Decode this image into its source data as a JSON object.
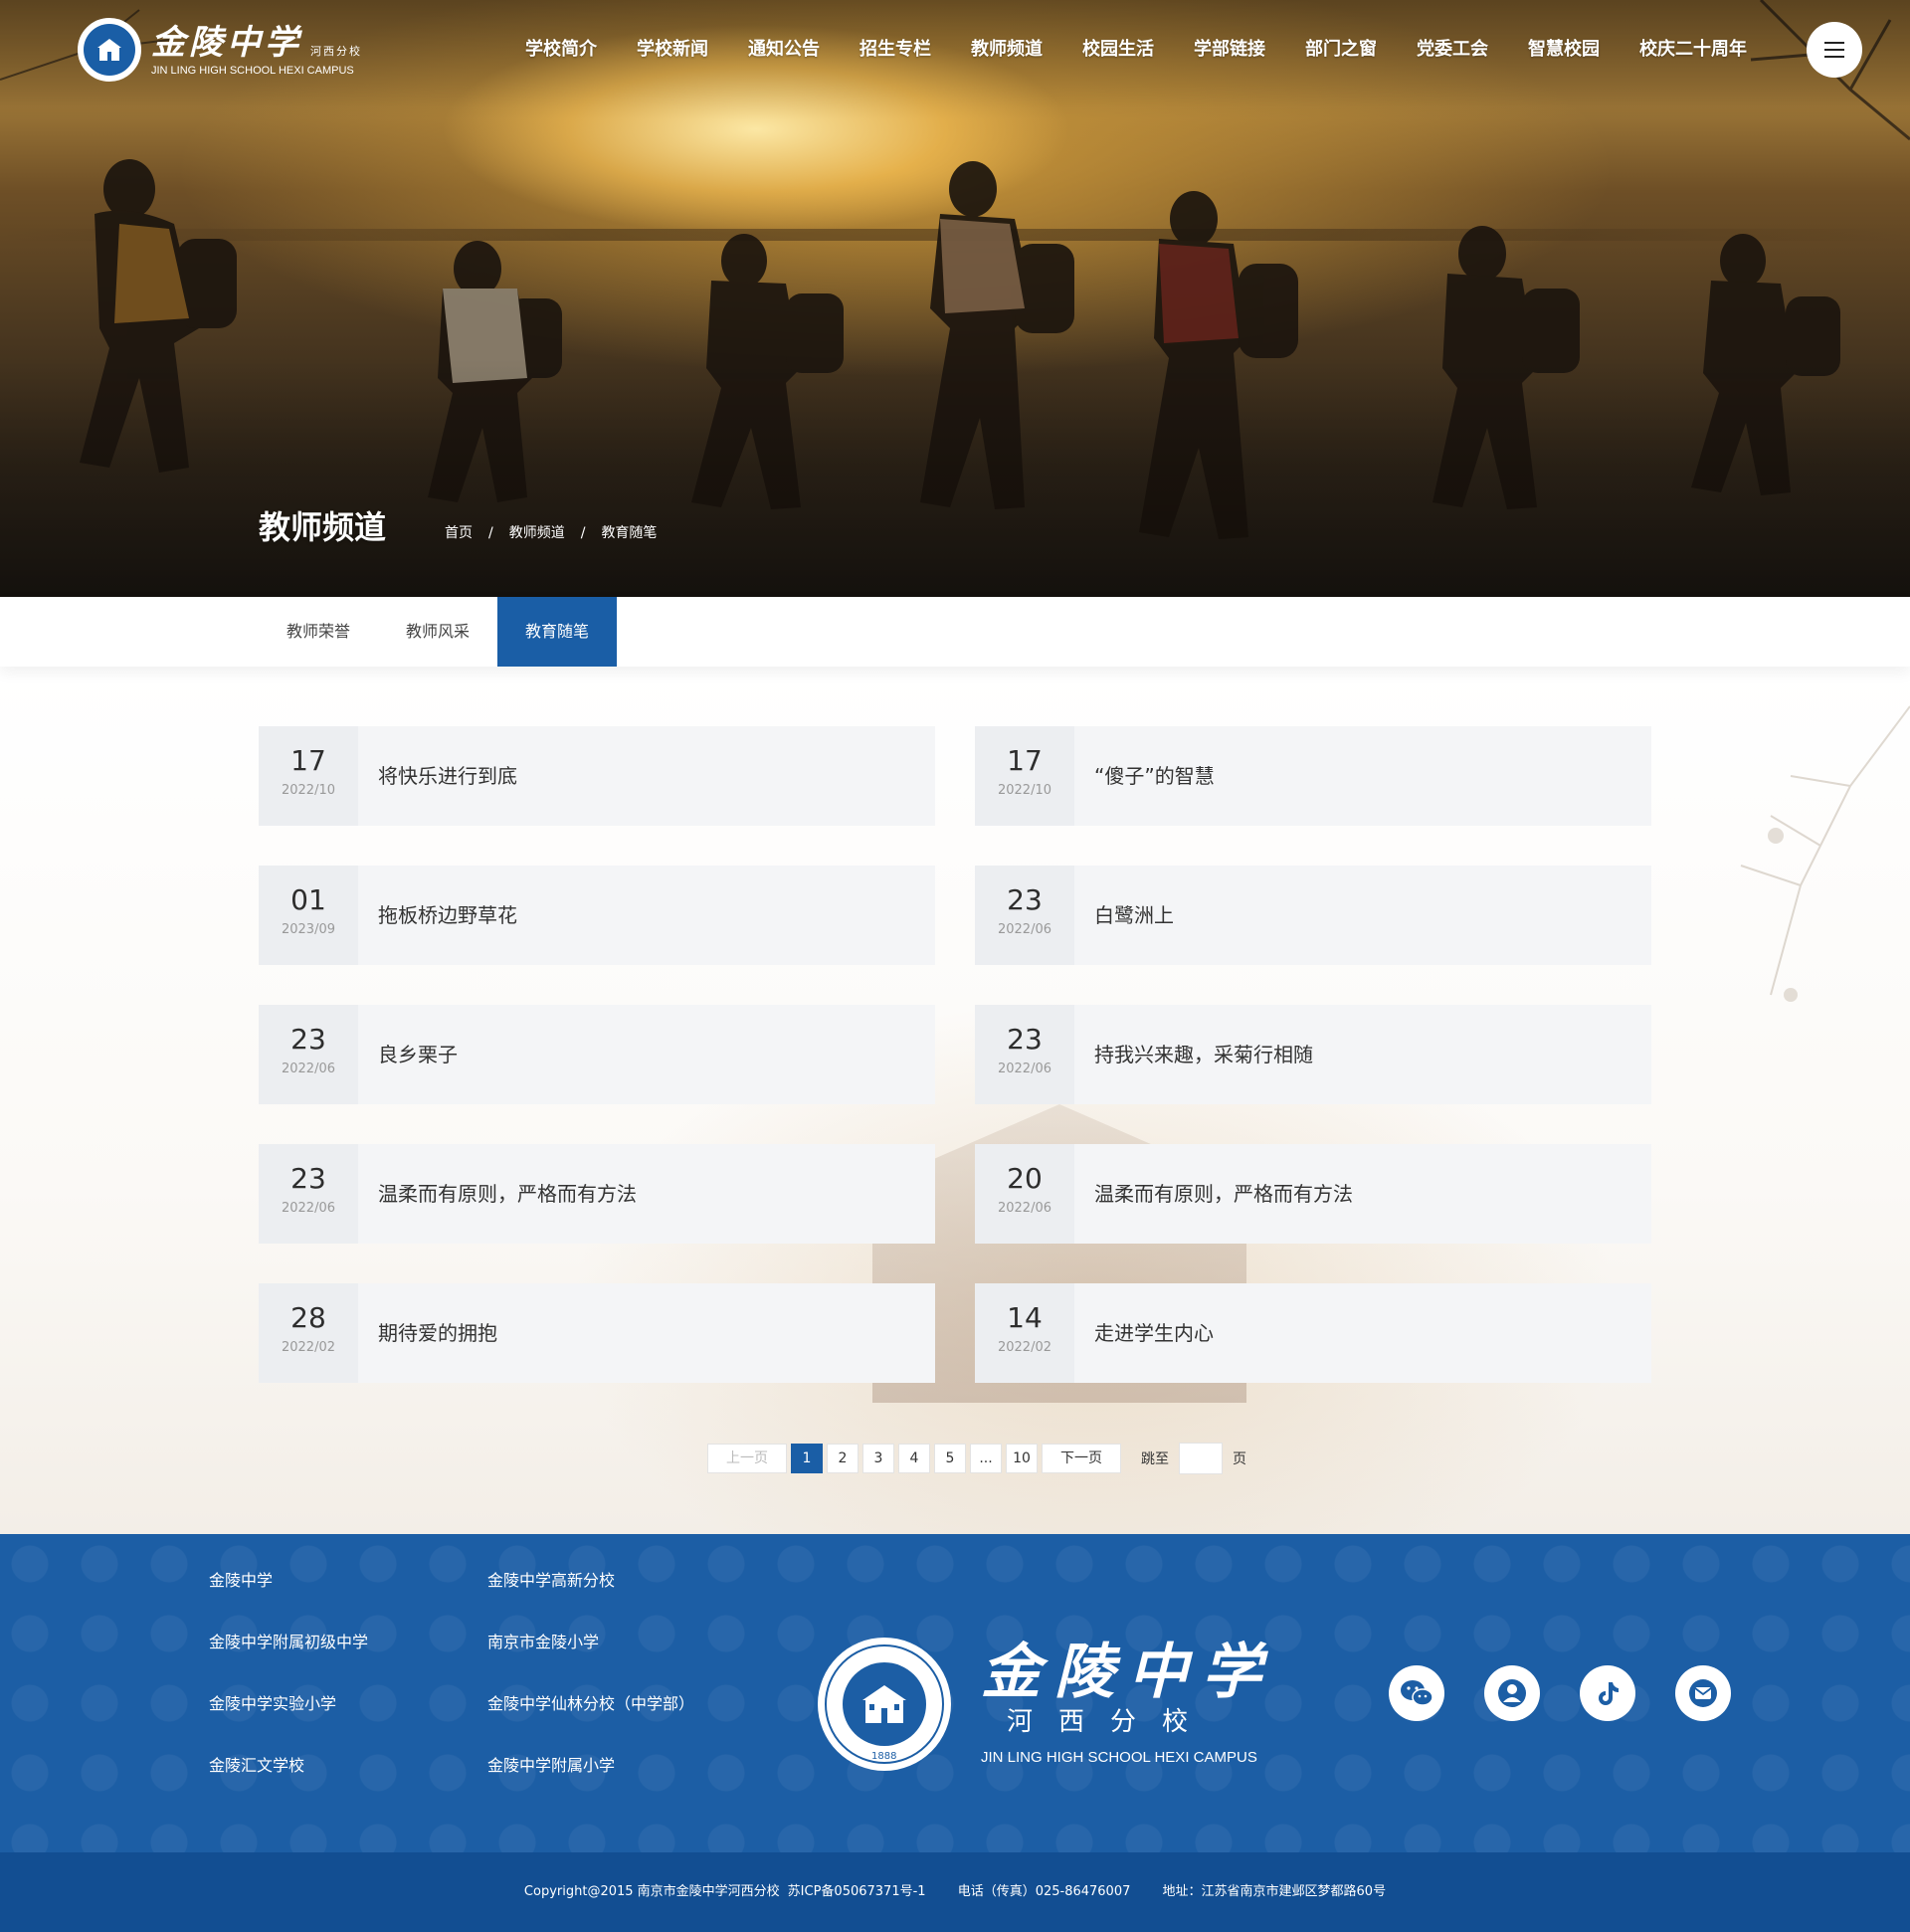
{
  "header": {
    "logo_cn": "金陵中学",
    "logo_campus": "河西分校",
    "logo_en": "JIN LING HIGH SCHOOL HEXI CAMPUS",
    "nav": [
      "学校简介",
      "学校新闻",
      "通知公告",
      "招生专栏",
      "教师频道",
      "校园生活",
      "学部链接",
      "部门之窗",
      "党委工会",
      "智慧校园",
      "校庆二十周年"
    ],
    "menu_icon": "hamburger-menu-icon"
  },
  "banner": {
    "title": "教师频道",
    "breadcrumb": [
      "首页",
      "教师频道",
      "教育随笔"
    ],
    "separator": "/"
  },
  "subtabs": {
    "items": [
      "教师荣誉",
      "教师风采",
      "教育随笔"
    ],
    "active": "教育随笔"
  },
  "articles": [
    {
      "day": "17",
      "ym": "2022/10",
      "title": "将快乐进行到底"
    },
    {
      "day": "17",
      "ym": "2022/10",
      "title": "“傻子”的智慧"
    },
    {
      "day": "01",
      "ym": "2023/09",
      "title": "拖板桥边野草花"
    },
    {
      "day": "23",
      "ym": "2022/06",
      "title": "白鹭洲上"
    },
    {
      "day": "23",
      "ym": "2022/06",
      "title": "良乡栗子"
    },
    {
      "day": "23",
      "ym": "2022/06",
      "title": "持我兴来趣，采菊行相随"
    },
    {
      "day": "23",
      "ym": "2022/06",
      "title": "温柔而有原则，严格而有方法"
    },
    {
      "day": "20",
      "ym": "2022/06",
      "title": "温柔而有原则，严格而有方法"
    },
    {
      "day": "28",
      "ym": "2022/02",
      "title": "期待爱的拥抱"
    },
    {
      "day": "14",
      "ym": "2022/02",
      "title": "走进学生内心"
    }
  ],
  "pagination": {
    "prev": "上一页",
    "pages": [
      "1",
      "2",
      "3",
      "4",
      "5",
      "...",
      "10"
    ],
    "current": "1",
    "next": "下一页",
    "jump_label": "跳至",
    "jump_suffix": "页"
  },
  "footer": {
    "links": [
      "金陵中学",
      "金陵中学高新分校",
      "金陵中学附属初级中学",
      "南京市金陵小学",
      "金陵中学实验小学",
      "金陵中学仙林分校（中学部）",
      "金陵汇文学校",
      "金陵中学附属小学"
    ],
    "school_cn": "金陵中学",
    "school_campus": "河西分校",
    "school_en": "JIN LING HIGH SCHOOL HEXI CAMPUS",
    "emblem_year": "1888",
    "social_icons": [
      "wechat-icon",
      "user-icon",
      "tiktok-icon",
      "mail-icon"
    ],
    "copyright": "Copyright@2015 南京市金陵中学河西分校",
    "icp": "苏ICP备05067371号-1",
    "phone": "电话（传真）025-86476007",
    "address": "地址：江苏省南京市建邺区梦都路60号"
  },
  "colors": {
    "brand_blue": "#1a5ea6",
    "footer_blue": "#1c5ea5",
    "copyright_blue": "#124e92"
  }
}
